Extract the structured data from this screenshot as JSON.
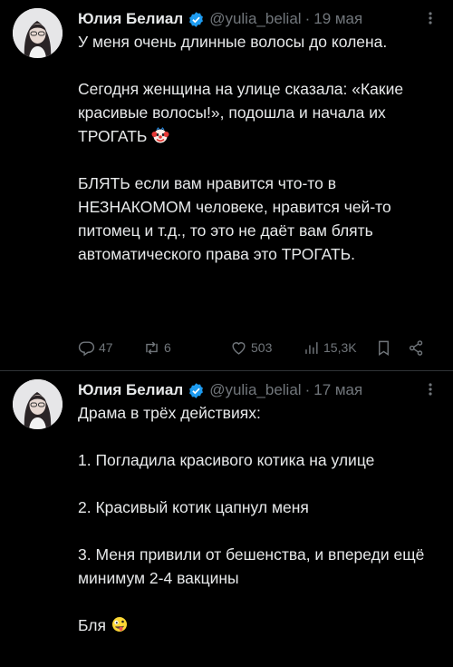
{
  "tweets": [
    {
      "author": {
        "name": "Юлия Белиал",
        "handle": "@yulia_belial",
        "date": "19 мая"
      },
      "paragraphs": [
        "У меня очень длинные волосы до колена.",
        "Сегодня женщина на улице сказала: «Какие красивые волосы!», подошла и начала их ТРОГАТЬ",
        "БЛЯТЬ если вам нравится что-то в НЕЗНАКОМОМ человеке, нравится чей-то питомец и т.д., то это не даёт вам блять автоматического права это ТРОГАТЬ."
      ],
      "emoji_icon": "clown-face-icon",
      "stats": {
        "replies": "47",
        "retweets": "6",
        "likes": "503",
        "views": "15,3K"
      }
    },
    {
      "author": {
        "name": "Юлия Белиал",
        "handle": "@yulia_belial",
        "date": "17 мая"
      },
      "paragraphs": [
        "Драма в трёх действиях:",
        "1. Погладила красивого котика на улице",
        "2. Красивый котик цапнул меня",
        "3. Меня привили от бешенства, и впереди ещё минимум 2-4 вакцины",
        "Бля"
      ],
      "emoji_icon": "zany-face-icon"
    }
  ],
  "colors": {
    "background": "#000000",
    "text": "#e7e9ea",
    "muted": "#71767b",
    "verified": "#1d9bf0",
    "divider": "#2f3336"
  },
  "separator": "·"
}
